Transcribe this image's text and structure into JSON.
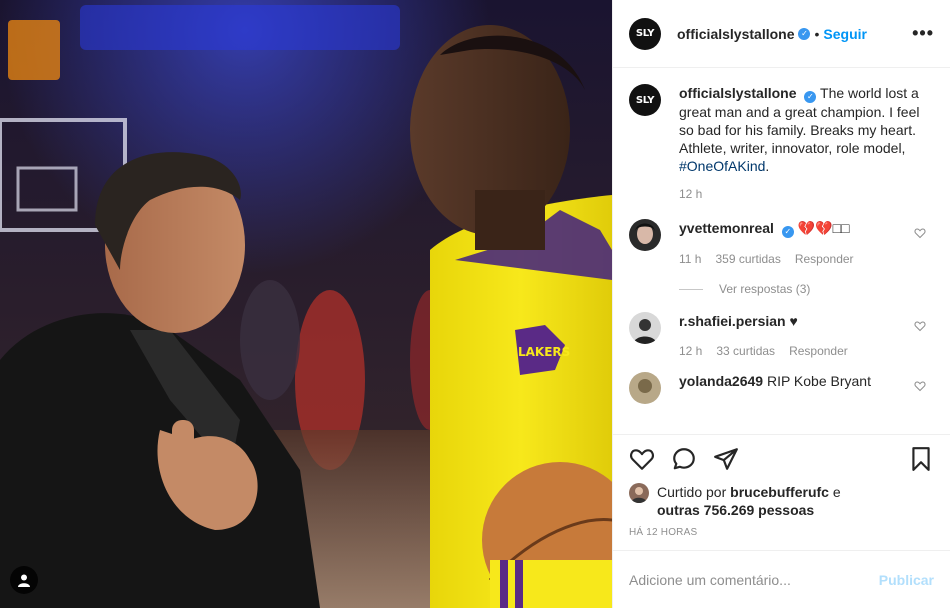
{
  "header": {
    "username": "officialslystallone",
    "avatar_text": "SLY",
    "separator": "•",
    "follow_label": "Seguir",
    "more_icon": "more-horizontal-icon"
  },
  "caption": {
    "username": "officialslystallone",
    "text": "The world lost a great man and a great champion. I feel so bad for his family. Breaks my heart. Athlete, writer, innovator, role model,",
    "hashtag": "#OneOfAKind",
    "time": "12 h"
  },
  "comments": [
    {
      "username": "yvettemonreal",
      "text": "💔💔□□",
      "verified": true,
      "time": "11 h",
      "likes": "359 curtidas",
      "reply_label": "Responder",
      "view_replies": "Ver respostas (3)"
    },
    {
      "username": "r.shafiei.persian",
      "text": "♥",
      "verified": false,
      "time": "12 h",
      "likes": "33 curtidas",
      "reply_label": "Responder"
    },
    {
      "username": "yolanda2649",
      "text": "RIP Kobe Bryant",
      "verified": false
    }
  ],
  "actions": {
    "like_icon": "heart-icon",
    "comment_icon": "comment-icon",
    "share_icon": "share-icon",
    "save_icon": "bookmark-icon"
  },
  "likes": {
    "prefix": "Curtido por",
    "user": "brucebufferufc",
    "middle": "e",
    "others": "outras 756.269 pessoas"
  },
  "posted_ago": "HÁ 12 HORAS",
  "add_comment": {
    "placeholder": "Adicione um comentário...",
    "publish_label": "Publicar"
  },
  "colors": {
    "link_blue": "#0095f6",
    "verified_blue": "#3897f0",
    "muted": "#8e8e8e",
    "disabled_publish": "#b2dffc"
  }
}
